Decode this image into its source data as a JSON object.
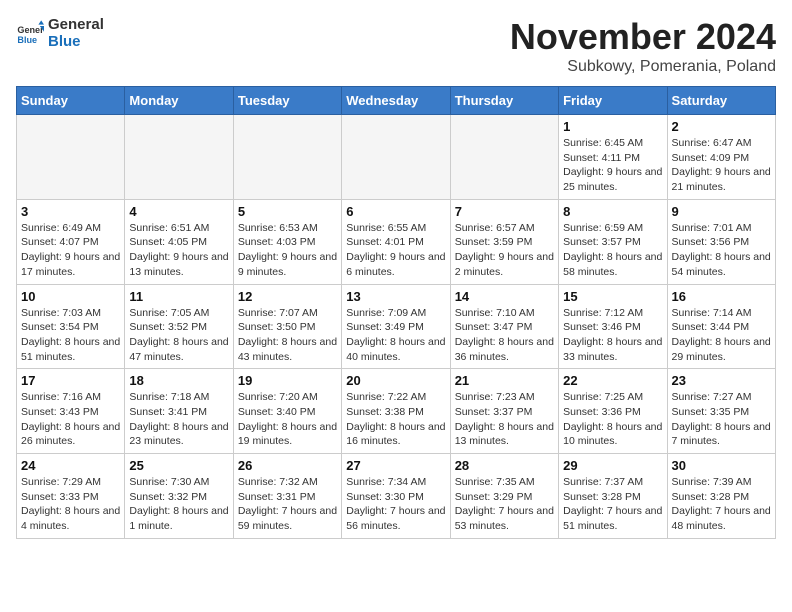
{
  "header": {
    "logo": {
      "general": "General",
      "blue": "Blue"
    },
    "month_title": "November 2024",
    "subtitle": "Subkowy, Pomerania, Poland"
  },
  "days_of_week": [
    "Sunday",
    "Monday",
    "Tuesday",
    "Wednesday",
    "Thursday",
    "Friday",
    "Saturday"
  ],
  "weeks": [
    [
      {
        "day": "",
        "sunrise": "",
        "sunset": "",
        "daylight": "",
        "empty": true
      },
      {
        "day": "",
        "sunrise": "",
        "sunset": "",
        "daylight": "",
        "empty": true
      },
      {
        "day": "",
        "sunrise": "",
        "sunset": "",
        "daylight": "",
        "empty": true
      },
      {
        "day": "",
        "sunrise": "",
        "sunset": "",
        "daylight": "",
        "empty": true
      },
      {
        "day": "",
        "sunrise": "",
        "sunset": "",
        "daylight": "",
        "empty": true
      },
      {
        "day": "1",
        "sunrise": "Sunrise: 6:45 AM",
        "sunset": "Sunset: 4:11 PM",
        "daylight": "Daylight: 9 hours and 25 minutes.",
        "empty": false
      },
      {
        "day": "2",
        "sunrise": "Sunrise: 6:47 AM",
        "sunset": "Sunset: 4:09 PM",
        "daylight": "Daylight: 9 hours and 21 minutes.",
        "empty": false
      }
    ],
    [
      {
        "day": "3",
        "sunrise": "Sunrise: 6:49 AM",
        "sunset": "Sunset: 4:07 PM",
        "daylight": "Daylight: 9 hours and 17 minutes.",
        "empty": false
      },
      {
        "day": "4",
        "sunrise": "Sunrise: 6:51 AM",
        "sunset": "Sunset: 4:05 PM",
        "daylight": "Daylight: 9 hours and 13 minutes.",
        "empty": false
      },
      {
        "day": "5",
        "sunrise": "Sunrise: 6:53 AM",
        "sunset": "Sunset: 4:03 PM",
        "daylight": "Daylight: 9 hours and 9 minutes.",
        "empty": false
      },
      {
        "day": "6",
        "sunrise": "Sunrise: 6:55 AM",
        "sunset": "Sunset: 4:01 PM",
        "daylight": "Daylight: 9 hours and 6 minutes.",
        "empty": false
      },
      {
        "day": "7",
        "sunrise": "Sunrise: 6:57 AM",
        "sunset": "Sunset: 3:59 PM",
        "daylight": "Daylight: 9 hours and 2 minutes.",
        "empty": false
      },
      {
        "day": "8",
        "sunrise": "Sunrise: 6:59 AM",
        "sunset": "Sunset: 3:57 PM",
        "daylight": "Daylight: 8 hours and 58 minutes.",
        "empty": false
      },
      {
        "day": "9",
        "sunrise": "Sunrise: 7:01 AM",
        "sunset": "Sunset: 3:56 PM",
        "daylight": "Daylight: 8 hours and 54 minutes.",
        "empty": false
      }
    ],
    [
      {
        "day": "10",
        "sunrise": "Sunrise: 7:03 AM",
        "sunset": "Sunset: 3:54 PM",
        "daylight": "Daylight: 8 hours and 51 minutes.",
        "empty": false
      },
      {
        "day": "11",
        "sunrise": "Sunrise: 7:05 AM",
        "sunset": "Sunset: 3:52 PM",
        "daylight": "Daylight: 8 hours and 47 minutes.",
        "empty": false
      },
      {
        "day": "12",
        "sunrise": "Sunrise: 7:07 AM",
        "sunset": "Sunset: 3:50 PM",
        "daylight": "Daylight: 8 hours and 43 minutes.",
        "empty": false
      },
      {
        "day": "13",
        "sunrise": "Sunrise: 7:09 AM",
        "sunset": "Sunset: 3:49 PM",
        "daylight": "Daylight: 8 hours and 40 minutes.",
        "empty": false
      },
      {
        "day": "14",
        "sunrise": "Sunrise: 7:10 AM",
        "sunset": "Sunset: 3:47 PM",
        "daylight": "Daylight: 8 hours and 36 minutes.",
        "empty": false
      },
      {
        "day": "15",
        "sunrise": "Sunrise: 7:12 AM",
        "sunset": "Sunset: 3:46 PM",
        "daylight": "Daylight: 8 hours and 33 minutes.",
        "empty": false
      },
      {
        "day": "16",
        "sunrise": "Sunrise: 7:14 AM",
        "sunset": "Sunset: 3:44 PM",
        "daylight": "Daylight: 8 hours and 29 minutes.",
        "empty": false
      }
    ],
    [
      {
        "day": "17",
        "sunrise": "Sunrise: 7:16 AM",
        "sunset": "Sunset: 3:43 PM",
        "daylight": "Daylight: 8 hours and 26 minutes.",
        "empty": false
      },
      {
        "day": "18",
        "sunrise": "Sunrise: 7:18 AM",
        "sunset": "Sunset: 3:41 PM",
        "daylight": "Daylight: 8 hours and 23 minutes.",
        "empty": false
      },
      {
        "day": "19",
        "sunrise": "Sunrise: 7:20 AM",
        "sunset": "Sunset: 3:40 PM",
        "daylight": "Daylight: 8 hours and 19 minutes.",
        "empty": false
      },
      {
        "day": "20",
        "sunrise": "Sunrise: 7:22 AM",
        "sunset": "Sunset: 3:38 PM",
        "daylight": "Daylight: 8 hours and 16 minutes.",
        "empty": false
      },
      {
        "day": "21",
        "sunrise": "Sunrise: 7:23 AM",
        "sunset": "Sunset: 3:37 PM",
        "daylight": "Daylight: 8 hours and 13 minutes.",
        "empty": false
      },
      {
        "day": "22",
        "sunrise": "Sunrise: 7:25 AM",
        "sunset": "Sunset: 3:36 PM",
        "daylight": "Daylight: 8 hours and 10 minutes.",
        "empty": false
      },
      {
        "day": "23",
        "sunrise": "Sunrise: 7:27 AM",
        "sunset": "Sunset: 3:35 PM",
        "daylight": "Daylight: 8 hours and 7 minutes.",
        "empty": false
      }
    ],
    [
      {
        "day": "24",
        "sunrise": "Sunrise: 7:29 AM",
        "sunset": "Sunset: 3:33 PM",
        "daylight": "Daylight: 8 hours and 4 minutes.",
        "empty": false
      },
      {
        "day": "25",
        "sunrise": "Sunrise: 7:30 AM",
        "sunset": "Sunset: 3:32 PM",
        "daylight": "Daylight: 8 hours and 1 minute.",
        "empty": false
      },
      {
        "day": "26",
        "sunrise": "Sunrise: 7:32 AM",
        "sunset": "Sunset: 3:31 PM",
        "daylight": "Daylight: 7 hours and 59 minutes.",
        "empty": false
      },
      {
        "day": "27",
        "sunrise": "Sunrise: 7:34 AM",
        "sunset": "Sunset: 3:30 PM",
        "daylight": "Daylight: 7 hours and 56 minutes.",
        "empty": false
      },
      {
        "day": "28",
        "sunrise": "Sunrise: 7:35 AM",
        "sunset": "Sunset: 3:29 PM",
        "daylight": "Daylight: 7 hours and 53 minutes.",
        "empty": false
      },
      {
        "day": "29",
        "sunrise": "Sunrise: 7:37 AM",
        "sunset": "Sunset: 3:28 PM",
        "daylight": "Daylight: 7 hours and 51 minutes.",
        "empty": false
      },
      {
        "day": "30",
        "sunrise": "Sunrise: 7:39 AM",
        "sunset": "Sunset: 3:28 PM",
        "daylight": "Daylight: 7 hours and 48 minutes.",
        "empty": false
      }
    ]
  ]
}
